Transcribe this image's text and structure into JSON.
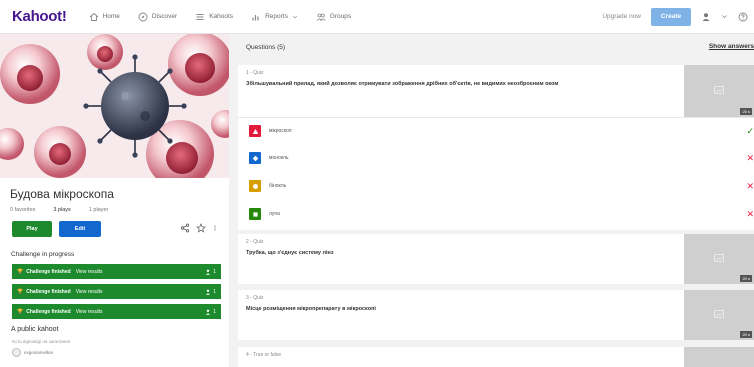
{
  "app": {
    "logo": "Kahoot!",
    "nav": [
      {
        "label": "Home",
        "icon": "home-icon"
      },
      {
        "label": "Discover",
        "icon": "compass-icon"
      },
      {
        "label": "Kahoots",
        "icon": "list-icon"
      },
      {
        "label": "Reports",
        "icon": "bar-chart-icon"
      },
      {
        "label": "Groups",
        "icon": "groups-icon"
      }
    ],
    "upgrade_label": "Upgrade now",
    "create_label": "Create"
  },
  "kahoot": {
    "title": "Будова мікроскопа",
    "favorites": "0 favorites",
    "plays": "3 plays",
    "players": "1 player",
    "play_label": "Play",
    "edit_label": "Edit",
    "challenge_heading": "Challenge in progress",
    "challenges": [
      {
        "status": "Challenge finished",
        "link": "View results",
        "count": "1"
      },
      {
        "status": "Challenge finished",
        "link": "View results",
        "count": "1"
      },
      {
        "status": "Challenge finished",
        "link": "View results",
        "count": "1"
      }
    ],
    "visibility": "A public kahoot",
    "visibility_sub": "Єсть відповіді на запитання",
    "creator": "evgeniamelkai"
  },
  "questions": {
    "header": "Questions (5)",
    "show_answers": "Show answers",
    "items": [
      {
        "type": "1 - Quiz",
        "text": "Збільшувальний прилад, який дозволяє отримувати зображення дрібних об'єктів, не видимих неозброєним оком",
        "time": "20 s",
        "answers": [
          {
            "label": "мікроскоп",
            "shape": "triangle",
            "color": "#e21b3c",
            "correct": true
          },
          {
            "label": "монокль",
            "shape": "diamond",
            "color": "#1368ce",
            "correct": false
          },
          {
            "label": "бінокль",
            "shape": "circle",
            "color": "#d89e00",
            "correct": false
          },
          {
            "label": "лупа",
            "shape": "square",
            "color": "#26890c",
            "correct": false
          }
        ]
      },
      {
        "type": "2 - Quiz",
        "text": "Трубка, що з'єднує систему лінз",
        "time": "20 s"
      },
      {
        "type": "3 - Quiz",
        "text": "Місце розміщення мікропрепарату в мікроскопі",
        "time": "20 s"
      },
      {
        "type": "4 - True or false",
        "text": "",
        "time": ""
      }
    ]
  }
}
